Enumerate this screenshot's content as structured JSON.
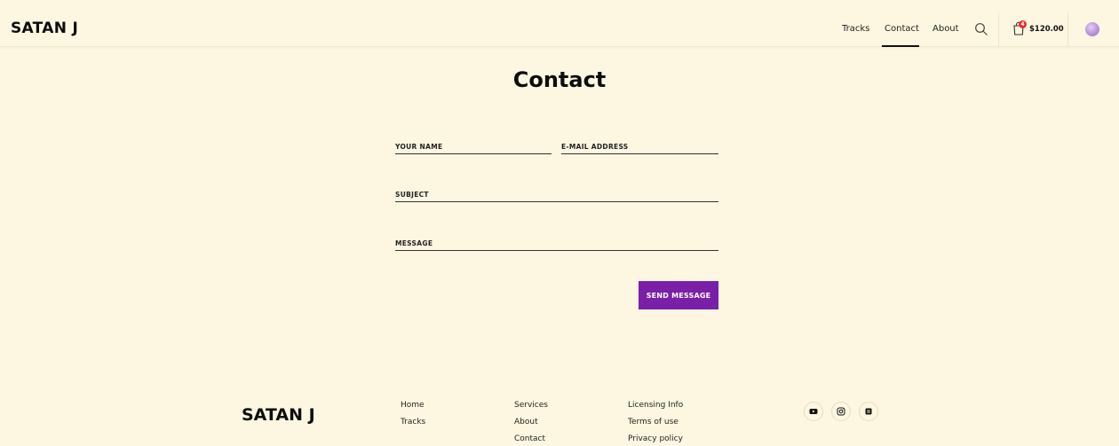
{
  "header": {
    "logo": "SATAN J",
    "nav": [
      {
        "label": "Tracks"
      },
      {
        "label": "Contact"
      },
      {
        "label": "About"
      }
    ],
    "cart_count": "4",
    "cart_total": "$120.00"
  },
  "main": {
    "title": "Contact",
    "form": {
      "name_placeholder": "YOUR NAME",
      "email_placeholder": "E-MAIL ADDRESS",
      "subject_placeholder": "SUBJECT",
      "message_placeholder": "MESSAGE",
      "submit_label": "SEND MESSAGE"
    }
  },
  "footer": {
    "logo": "SATAN J",
    "col1": [
      "Home",
      "Tracks"
    ],
    "col2": [
      "Services",
      "About",
      "Contact"
    ],
    "col3": [
      "Licensing Info",
      "Terms of use",
      "Privacy policy"
    ],
    "social": [
      "youtube-icon",
      "instagram-icon",
      "beatstars-icon"
    ]
  },
  "colors": {
    "background": "#fdf7e1",
    "accent": "#7a1fa8",
    "badge": "#e5322a"
  }
}
